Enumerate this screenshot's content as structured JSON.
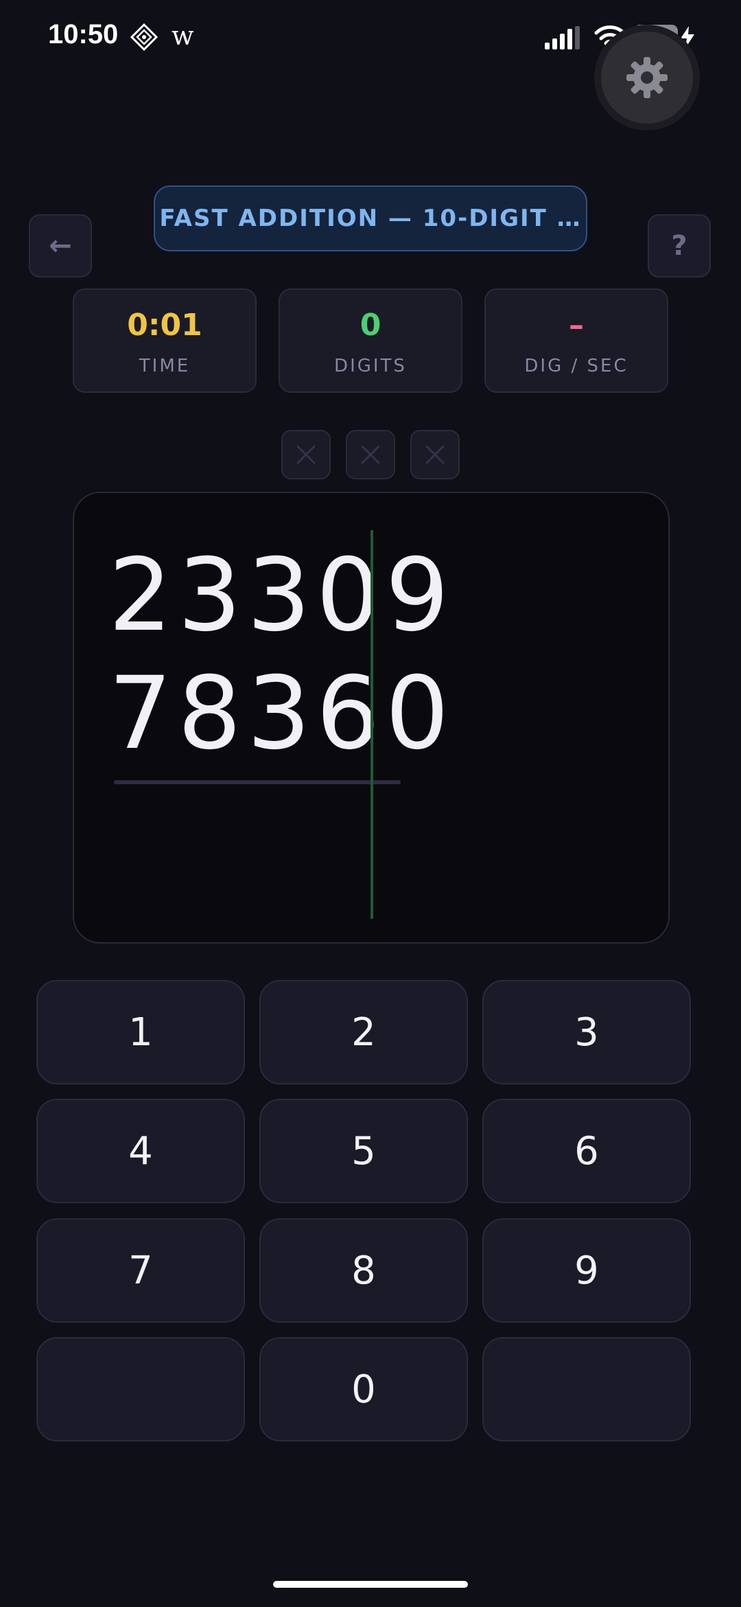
{
  "status_bar": {
    "time": "10:50",
    "app_letter": "w",
    "battery_level": "27",
    "battery_fraction": 0.27
  },
  "header": {
    "title": "FAST ADDITION — 10-DIGIT …",
    "back_icon": "←",
    "help_label": "?"
  },
  "stats": [
    {
      "value": "0:01",
      "label": "TIME",
      "color": "#f0c542"
    },
    {
      "value": "0",
      "label": "DIGITS",
      "color": "#4ccf73"
    },
    {
      "value": "–",
      "label": "DIG / SEC",
      "color": "#f06a93"
    }
  ],
  "strikes": [
    "x-icon",
    "x-icon",
    "x-icon"
  ],
  "problem": {
    "operand_1": "23309",
    "operand_2": "78360",
    "answer": ""
  },
  "keypad": {
    "keys": [
      "1",
      "2",
      "3",
      "4",
      "5",
      "6",
      "7",
      "8",
      "9",
      "",
      "0",
      ""
    ]
  },
  "colors": {
    "background": "#0f0f17",
    "accent_blue": "#7fb6f0",
    "time": "#f0c542",
    "digits": "#4ccf73",
    "rate": "#f06a93"
  }
}
